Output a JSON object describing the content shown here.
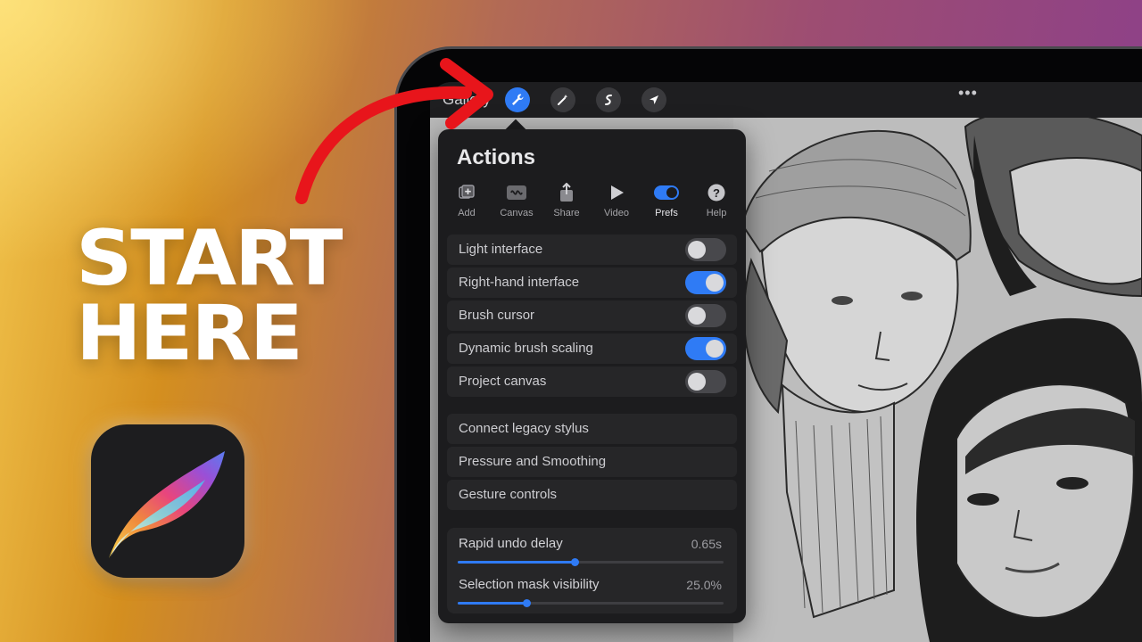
{
  "thumbnail": {
    "headline_line1": "START",
    "headline_line2": "HERE",
    "accent_arrow_color": "#e8151b"
  },
  "toolbar": {
    "gallery_label": "Gallery",
    "tools": [
      "wrench-icon",
      "magic-wand-icon",
      "selection-icon",
      "transform-arrow-icon"
    ],
    "active_tool": "wrench-icon",
    "more_label": "•••"
  },
  "actions_panel": {
    "title": "Actions",
    "tabs": [
      {
        "label": "Add",
        "icon": "add-icon"
      },
      {
        "label": "Canvas",
        "icon": "canvas-icon"
      },
      {
        "label": "Share",
        "icon": "share-icon"
      },
      {
        "label": "Video",
        "icon": "play-icon"
      },
      {
        "label": "Prefs",
        "icon": "toggle-icon",
        "active": true
      },
      {
        "label": "Help",
        "icon": "help-icon"
      }
    ],
    "toggles": [
      {
        "label": "Light interface",
        "on": false
      },
      {
        "label": "Right-hand interface",
        "on": true
      },
      {
        "label": "Brush cursor",
        "on": false
      },
      {
        "label": "Dynamic brush scaling",
        "on": true
      },
      {
        "label": "Project canvas",
        "on": false
      }
    ],
    "links": [
      {
        "label": "Connect legacy stylus"
      },
      {
        "label": "Pressure and Smoothing"
      },
      {
        "label": "Gesture controls"
      }
    ],
    "sliders": [
      {
        "label": "Rapid undo delay",
        "value": "0.65s",
        "fraction": 0.44
      },
      {
        "label": "Selection mask visibility",
        "value": "25.0%",
        "fraction": 0.26
      }
    ]
  },
  "colors": {
    "accent_blue": "#2f7bf5",
    "panel_bg": "#1c1c1e",
    "row_bg": "#262628"
  }
}
